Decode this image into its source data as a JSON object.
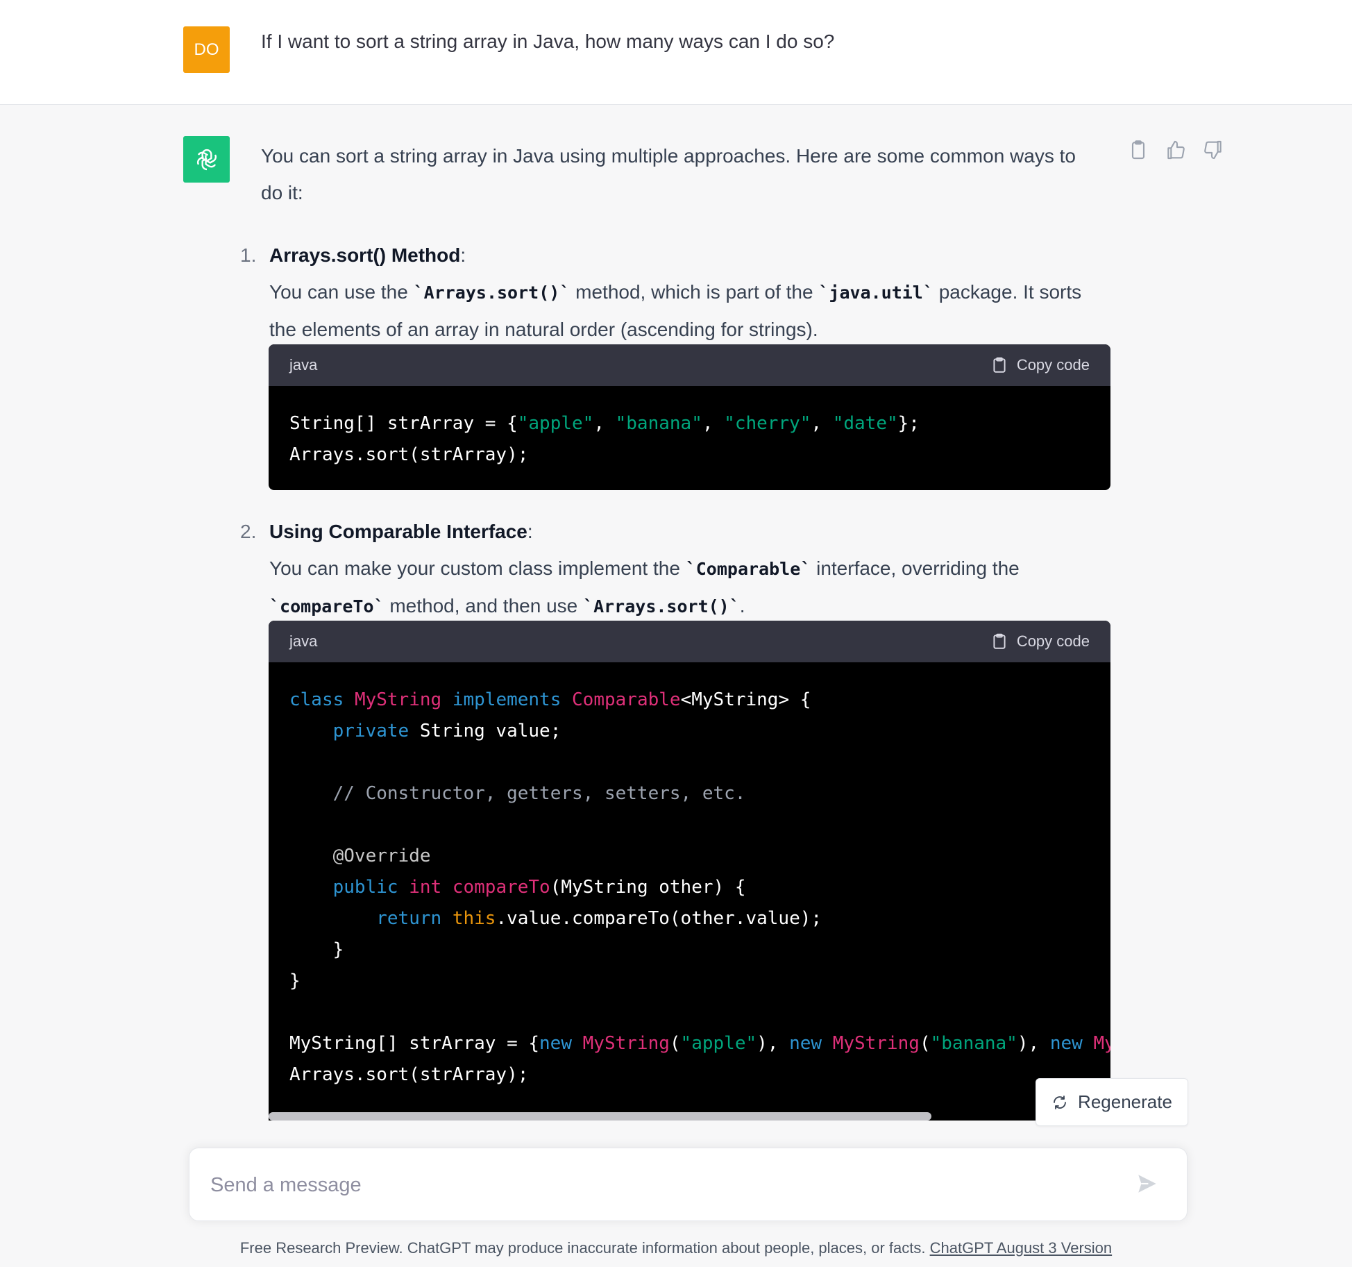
{
  "user_message": {
    "avatar": "DO",
    "text": "If I want to sort a string array in Java, how many ways can I do so?"
  },
  "assistant": {
    "intro": "You can sort a string array in Java using multiple approaches. Here are some common ways to do it:",
    "action_icons": [
      "clipboard-icon",
      "thumbs-up-icon",
      "thumbs-down-icon"
    ],
    "items": [
      {
        "number": "1.",
        "title": "Arrays.sort() Method",
        "title_suffix": ":",
        "desc_a": "You can use the ",
        "code_a": "`Arrays.sort()`",
        "desc_b": " method, which is part of the ",
        "code_b": "`java.util`",
        "desc_c": " package. It sorts the elements of an array in natural order (ascending for strings)."
      },
      {
        "number": "2.",
        "title": "Using Comparable Interface",
        "title_suffix": ":",
        "desc_a": "You can make your custom class implement the ",
        "code_a": "`Comparable`",
        "desc_b": " interface, overriding the ",
        "code_b": "`compareTo`",
        "desc_c": " method, and then use ",
        "code_c": "`Arrays.sort()`",
        "desc_d": "."
      }
    ],
    "code_blocks": [
      {
        "language": "java",
        "copy_label": "Copy code"
      },
      {
        "language": "java",
        "copy_label": "Copy code"
      }
    ]
  },
  "regenerate_label": "Regenerate",
  "composer": {
    "placeholder": "Send a message"
  },
  "footer": {
    "text": "Free Research Preview. ChatGPT may produce inaccurate information about people, places, or facts. ",
    "link": "ChatGPT August 3 Version"
  },
  "colors": {
    "user_avatar": "#f59e0b",
    "bot_avatar": "#19c37d",
    "keyword": "#2e95d3",
    "class_name": "#df3079",
    "string": "#00a67d",
    "this_kw": "#e9950c"
  }
}
